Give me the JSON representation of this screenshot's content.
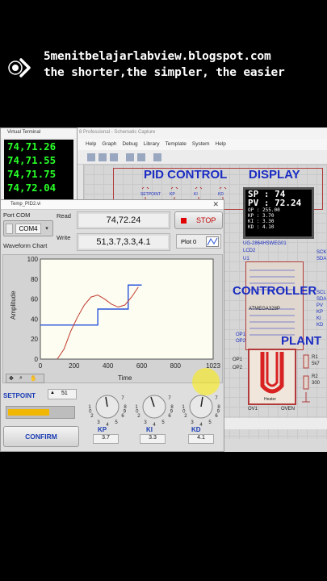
{
  "banner": {
    "line1": "5menitbelajarlabview.blogspot.com",
    "line2": "the shorter,the simpler, the easier"
  },
  "proteus": {
    "window_title": "8 Professional - Schematic Capture",
    "menu": [
      "Help",
      "Graph",
      "Debug",
      "Library",
      "Template",
      "System",
      "Help"
    ],
    "schematic": {
      "pid_control": "PID CONTROL",
      "display": "DISPLAY",
      "controller": "CONTROLLER",
      "plant": "PLANT",
      "lcd_sp": "SP : 74",
      "lcd_pv": "PV : 72.24",
      "lcd_op": "OP : 255.00",
      "lcd_kp": "KP : 3.70",
      "lcd_ki": "KI : 3.30",
      "lcd_kd": "KD : 4.10",
      "lcd_part": "UG-2864HSWEG01",
      "lcd_ref": "LCD2",
      "mcu_ref": "U1",
      "mcu_part": "ATMEGA328P",
      "pins_top": [
        "SETPOINT",
        "KP",
        "KI",
        "KD"
      ],
      "pins_right": [
        "SCL",
        "SDA",
        "PV",
        "KP",
        "KI",
        "KD",
        "SCK",
        "SDA"
      ],
      "op_pins": [
        "OP1",
        "OP2",
        "OP1",
        "OP2"
      ],
      "oven_labels": [
        "Heater",
        "OV1",
        "OVEN"
      ],
      "resistors": [
        "R1",
        "5k7",
        "R2",
        "300"
      ]
    }
  },
  "terminal": {
    "title": "Virtual Terminal",
    "lines": [
      "74,71.26",
      "74,71.55",
      "74,71.75",
      "74,72.04"
    ]
  },
  "labview": {
    "title": "Temp_PID2.vi",
    "port_label": "Port COM",
    "port_value": "COM4",
    "read_label": "Read",
    "read_value": "74,72.24",
    "write_label": "Write",
    "write_value": "51,3.7,3.3,4.1",
    "stop_label": "STOP",
    "plot_legend": "Plot 0",
    "chart_label": "Waveform Chart",
    "setpoint_label": "SETPOINT",
    "setpoint_value": "51",
    "setpoint_level": 0.62,
    "confirm_label": "CONFIRM",
    "knobs": [
      {
        "name": "KP",
        "value": "3.7"
      },
      {
        "name": "KI",
        "value": "3.3"
      },
      {
        "name": "KD",
        "value": "4.1"
      }
    ],
    "knob_scale": [
      "6",
      "5",
      "4",
      "3",
      "7",
      "2",
      "8",
      "1",
      "9",
      "0"
    ],
    "colors": {
      "stop_red": "#e00000",
      "setpoint_fill": "#f2b705",
      "pv_curve": "#c0392b",
      "sp_curve": "#2a54d9"
    }
  },
  "chart_data": {
    "type": "line",
    "xlabel": "Time",
    "ylabel": "Amplitude",
    "xlim": [
      0,
      1023
    ],
    "ylim": [
      0,
      100
    ],
    "x_ticks": [
      "0",
      "200",
      "400",
      "600",
      "800",
      "1023"
    ],
    "y_ticks": [
      "0",
      "20",
      "40",
      "60",
      "80",
      "100"
    ],
    "series": [
      {
        "x": [
          0,
          20,
          60,
          100,
          120,
          300,
          300,
          340,
          380,
          420,
          450,
          470,
          480,
          500,
          520,
          560,
          600
        ],
        "y": [
          34,
          34,
          34,
          34,
          34,
          34,
          34,
          50,
          50,
          50,
          50,
          50,
          50,
          50,
          74,
          74,
          74
        ]
      },
      {
        "x": [
          100,
          140,
          180,
          220,
          260,
          300,
          340,
          380,
          420,
          460,
          500,
          540,
          580
        ],
        "y": [
          0,
          10,
          28,
          42,
          54,
          62,
          64,
          60,
          55,
          52,
          54,
          62,
          72
        ]
      }
    ]
  }
}
